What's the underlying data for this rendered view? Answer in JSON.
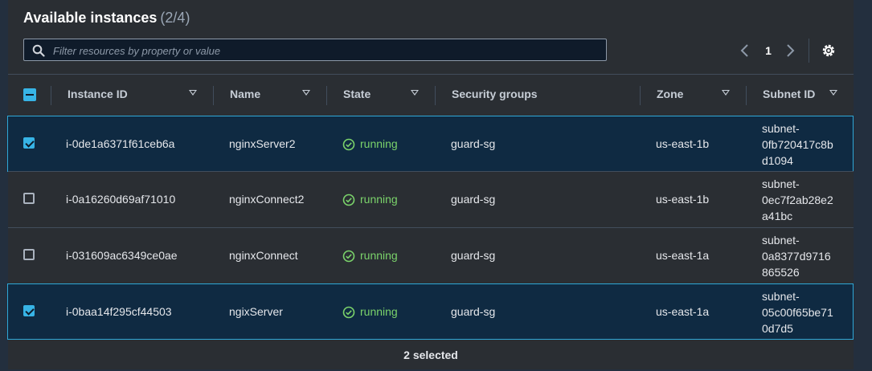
{
  "header": {
    "title": "Available instances",
    "count": "(2/4)"
  },
  "search": {
    "placeholder": "Filter resources by property or value",
    "value": ""
  },
  "pagination": {
    "page": "1"
  },
  "columns": {
    "instance_id": "Instance ID",
    "name": "Name",
    "state": "State",
    "security_groups": "Security groups",
    "zone": "Zone",
    "subnet_id": "Subnet ID"
  },
  "rows": [
    {
      "selected": true,
      "instance_id": "i-0de1a6371f61ceb6a",
      "name": "nginxServer2",
      "state": "running",
      "security_group": "guard-sg",
      "zone": "us-east-1b",
      "subnet_line1": "subnet-",
      "subnet_line2": "0fb720417c8b",
      "subnet_line3": "d1094"
    },
    {
      "selected": false,
      "instance_id": "i-0a16260d69af71010",
      "name": "nginxConnect2",
      "state": "running",
      "security_group": "guard-sg",
      "zone": "us-east-1b",
      "subnet_line1": "subnet-",
      "subnet_line2": "0ec7f2ab28e2",
      "subnet_line3": "a41bc"
    },
    {
      "selected": false,
      "instance_id": "i-031609ac6349ce0ae",
      "name": "nginxConnect",
      "state": "running",
      "security_group": "guard-sg",
      "zone": "us-east-1a",
      "subnet_line1": "subnet-",
      "subnet_line2": "0a8377d9716",
      "subnet_line3": "865526"
    },
    {
      "selected": true,
      "instance_id": "i-0baa14f295cf44503",
      "name": "ngixServer",
      "state": "running",
      "security_group": "guard-sg",
      "zone": "us-east-1a",
      "subnet_line1": "subnet-",
      "subnet_line2": "05c00f65be71",
      "subnet_line3": "0d7d5"
    }
  ],
  "footer": {
    "selected_text": "2 selected"
  },
  "colors": {
    "accent": "#37b4e6",
    "running": "#7bd36b",
    "selected_row_bg": "#0f2a42",
    "panel_bg": "#2a2e33"
  }
}
